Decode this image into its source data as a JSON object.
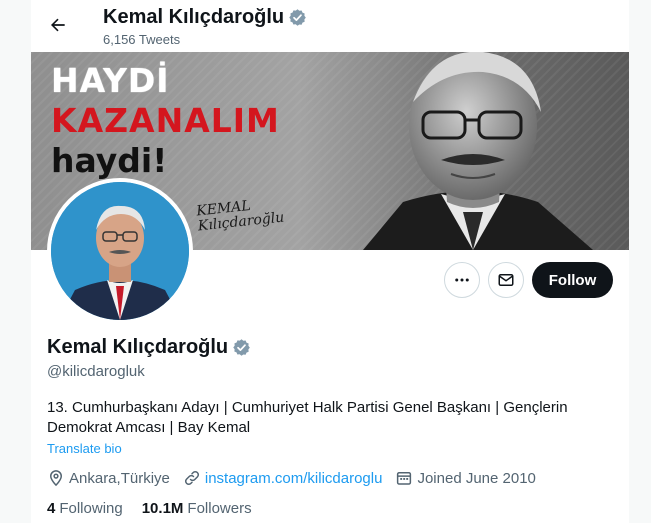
{
  "header": {
    "name": "Kemal Kılıçdaroğlu",
    "tweet_count": "6,156 Tweets"
  },
  "banner": {
    "line1": "HAYDİ",
    "line2": "KAZANALIM",
    "line3": "haydi!",
    "signature_line1": "KEMAL",
    "signature_line2": "Kılıçdaroğlu"
  },
  "actions": {
    "follow_label": "Follow"
  },
  "profile": {
    "name": "Kemal Kılıçdaroğlu",
    "handle": "@kilicdarogluk",
    "bio": "13. Cumhurbaşkanı Adayı | Cumhuriyet Halk Partisi Genel Başkanı | Gençlerin Demokrat Amcası | Bay Kemal",
    "translate": "Translate bio",
    "location": "Ankara,Türkiye",
    "website": "instagram.com/kilicdaroglu",
    "joined": "Joined June 2010",
    "following_count": "4",
    "following_label": "Following",
    "followers_count": "10.1M",
    "followers_label": "Followers"
  },
  "icons": {
    "back": "arrow-left-icon",
    "verified": "verified-badge-icon",
    "more": "more-horizontal-icon",
    "message": "envelope-icon",
    "location": "location-pin-icon",
    "link": "link-icon",
    "calendar": "calendar-icon"
  },
  "colors": {
    "accent": "#1d9bf0",
    "verified": "#829aab",
    "text_secondary": "#536471",
    "follow_button_bg": "#0f1419",
    "slogan_red": "#d4161e"
  }
}
